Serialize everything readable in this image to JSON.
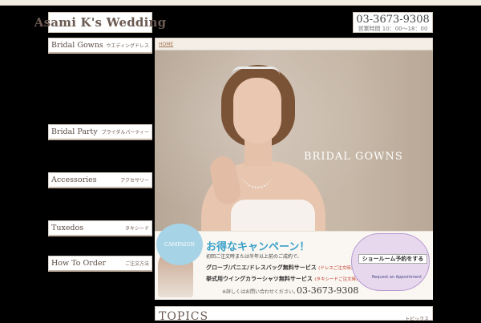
{
  "header": {
    "logo": "Asami K's Wedding",
    "tagline": "",
    "phone": "03-3673-9308",
    "hours": "営業時間 10：00～18：00"
  },
  "sidebar": {
    "categories": [
      {
        "title": "Bridal Gowns",
        "jp": "ウエディングドレス",
        "items": [
          "",
          "",
          "",
          "",
          ""
        ]
      },
      {
        "title": "Bridal Party",
        "jp": "ブライダルパーティー",
        "items": [
          "",
          ""
        ]
      },
      {
        "title": "Accessories",
        "jp": "アクセサリー",
        "items": [
          "",
          ""
        ]
      },
      {
        "title": "Tuxedos",
        "jp": "タキシード",
        "items": [
          ""
        ]
      },
      {
        "title": "How To Order",
        "jp": "ご注文方法",
        "items": [
          "",
          "",
          ""
        ]
      }
    ]
  },
  "main": {
    "breadcrumb": "HOME",
    "hero_title": "BRIDAL GOWNS",
    "banner": {
      "badge": "CAMPAIGN",
      "headline": "お得なキャンペーン！",
      "line1": "初回ご注文時または半年以上前のご成約で、",
      "line2": "グローブ/パニエ/ドレスバッグ無料サービス",
      "line2_note": "(ドレスご注文時)",
      "line3": "挙式用ウイングカラーシャツ無料サービス",
      "line3_note": "(タキシードご注文時)",
      "contact": "※詳しくはお問い合わせください。",
      "phone": "03-3673-9308",
      "showroom": "ショールーム予約をする",
      "appointment": "Request an Appointment"
    },
    "topics_title": "TOPICS",
    "topics_jp": "トピックス"
  }
}
